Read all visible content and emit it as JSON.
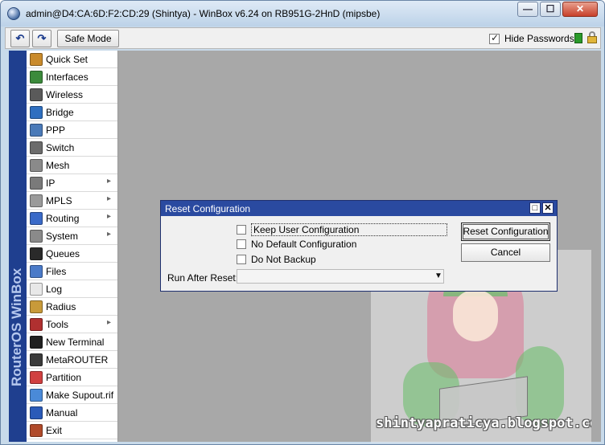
{
  "window": {
    "title": "admin@D4:CA:6D:F2:CD:29 (Shintya) - WinBox v6.24 on RB951G-2HnD (mipsbe)",
    "controls": {
      "minimize": "—",
      "maximize": "☐",
      "close": "✕"
    }
  },
  "toolbar": {
    "undo_icon": "undo-icon",
    "redo_icon": "redo-icon",
    "safe_mode_label": "Safe Mode",
    "hide_passwords_label": "Hide Passwords",
    "hide_passwords_checked": true
  },
  "sidebar": {
    "brand": "RouterOS WinBox",
    "items": [
      {
        "label": "Quick Set",
        "icon": "quick-set-icon",
        "color": "#c98a2b",
        "submenu": false
      },
      {
        "label": "Interfaces",
        "icon": "interfaces-icon",
        "color": "#3b8a3b",
        "submenu": false
      },
      {
        "label": "Wireless",
        "icon": "wireless-icon",
        "color": "#5a5a5a",
        "submenu": false
      },
      {
        "label": "Bridge",
        "icon": "bridge-icon",
        "color": "#2f6fc0",
        "submenu": false
      },
      {
        "label": "PPP",
        "icon": "ppp-icon",
        "color": "#4a7ab8",
        "submenu": false
      },
      {
        "label": "Switch",
        "icon": "switch-icon",
        "color": "#6b6b6b",
        "submenu": false
      },
      {
        "label": "Mesh",
        "icon": "mesh-icon",
        "color": "#8a8a8a",
        "submenu": false
      },
      {
        "label": "IP",
        "icon": "ip-icon",
        "color": "#7a7a7a",
        "submenu": true
      },
      {
        "label": "MPLS",
        "icon": "mpls-icon",
        "color": "#9a9a9a",
        "submenu": true
      },
      {
        "label": "Routing",
        "icon": "routing-icon",
        "color": "#3a6ac8",
        "submenu": true
      },
      {
        "label": "System",
        "icon": "system-icon",
        "color": "#8a8a8a",
        "submenu": true
      },
      {
        "label": "Queues",
        "icon": "queues-icon",
        "color": "#2a2a2a",
        "submenu": false
      },
      {
        "label": "Files",
        "icon": "files-icon",
        "color": "#4a7ac8",
        "submenu": false
      },
      {
        "label": "Log",
        "icon": "log-icon",
        "color": "#e8e8e8",
        "submenu": false
      },
      {
        "label": "Radius",
        "icon": "radius-icon",
        "color": "#c89a3a",
        "submenu": false
      },
      {
        "label": "Tools",
        "icon": "tools-icon",
        "color": "#b03030",
        "submenu": true
      },
      {
        "label": "New Terminal",
        "icon": "terminal-icon",
        "color": "#202020",
        "submenu": false
      },
      {
        "label": "MetaROUTER",
        "icon": "metarouter-icon",
        "color": "#3a3a3a",
        "submenu": false
      },
      {
        "label": "Partition",
        "icon": "partition-icon",
        "color": "#d04040",
        "submenu": false
      },
      {
        "label": "Make Supout.rif",
        "icon": "supout-icon",
        "color": "#4a8ad8",
        "submenu": false
      },
      {
        "label": "Manual",
        "icon": "manual-icon",
        "color": "#2a5ab8",
        "submenu": false
      },
      {
        "label": "Exit",
        "icon": "exit-icon",
        "color": "#b04a2a",
        "submenu": false
      }
    ]
  },
  "dialog": {
    "title": "Reset Configuration",
    "options": [
      {
        "label": "Keep User Configuration",
        "checked": false
      },
      {
        "label": "No Default Configuration",
        "checked": false
      },
      {
        "label": "Do Not Backup",
        "checked": false
      }
    ],
    "run_after_reset_label": "Run After Reset:",
    "run_after_reset_value": "",
    "reset_button": "Reset Configuration",
    "cancel_button": "Cancel"
  },
  "watermark": {
    "text": "shintyapraticya.blogspot.com"
  }
}
